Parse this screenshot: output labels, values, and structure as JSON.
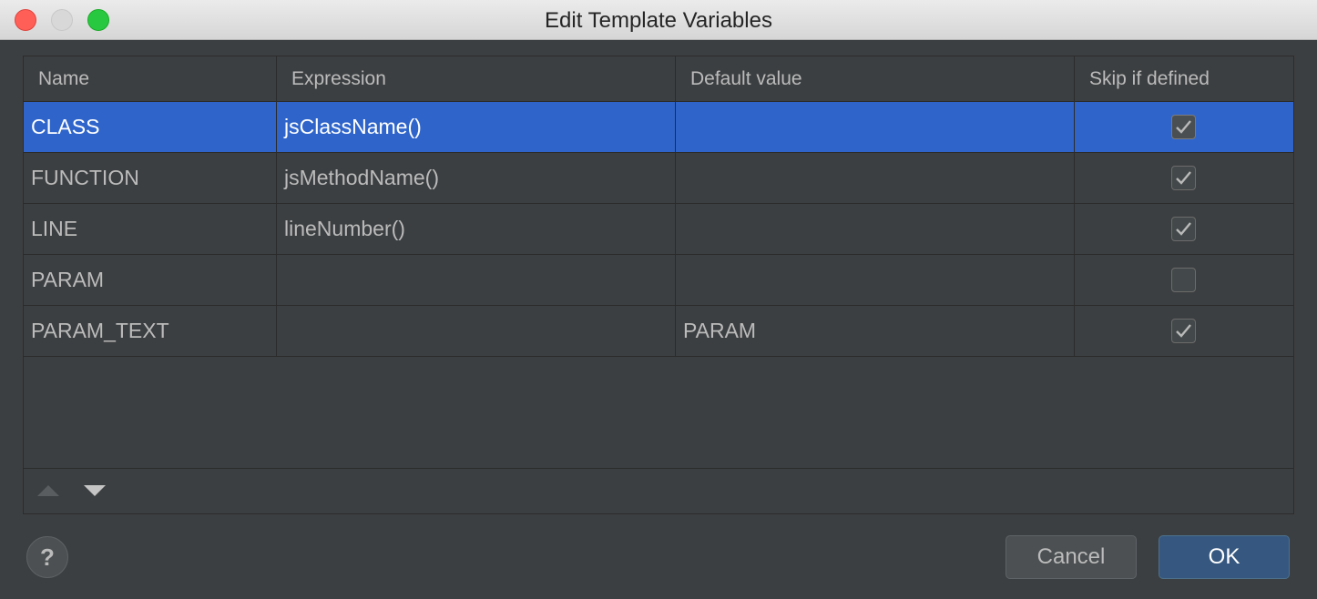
{
  "window": {
    "title": "Edit Template Variables"
  },
  "table": {
    "columns": [
      "Name",
      "Expression",
      "Default value",
      "Skip if defined"
    ],
    "rows": [
      {
        "name": "CLASS",
        "expression": "jsClassName()",
        "default": "",
        "skip": true,
        "selected": true
      },
      {
        "name": "FUNCTION",
        "expression": "jsMethodName()",
        "default": "",
        "skip": true,
        "selected": false
      },
      {
        "name": "LINE",
        "expression": "lineNumber()",
        "default": "",
        "skip": true,
        "selected": false
      },
      {
        "name": "PARAM",
        "expression": "",
        "default": "",
        "skip": false,
        "selected": false
      },
      {
        "name": "PARAM_TEXT",
        "expression": "",
        "default": "PARAM",
        "skip": true,
        "selected": false
      }
    ]
  },
  "toolbar": {
    "move_up_icon": "arrow-up-icon",
    "move_down_icon": "arrow-down-icon"
  },
  "footer": {
    "help_label": "?",
    "cancel_label": "Cancel",
    "ok_label": "OK"
  },
  "colors": {
    "selection": "#2f65ca",
    "background": "#3c3f41",
    "ok_button": "#365880"
  }
}
